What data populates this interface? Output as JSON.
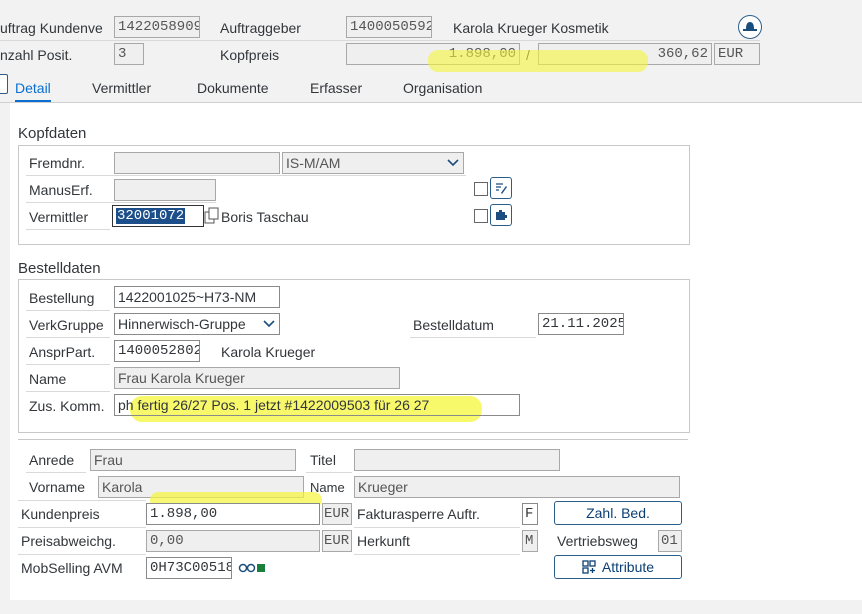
{
  "header": {
    "auftrag_label": "uftrag Kundenve",
    "auftrag_value": "1422058909",
    "auftraggeber_label": "Auftraggeber",
    "auftraggeber_value": "1400050592",
    "auftraggeber_name": "Karola Krueger Kosmetik",
    "anzahl_label": "nzahl Posit.",
    "anzahl_value": "3",
    "kopfpreis_label": "Kopfpreis",
    "kopfpreis_value": "1.898,00",
    "separator": "/",
    "kopfpreis_second": "360,62",
    "currency": "EUR"
  },
  "tabs": [
    "Detail",
    "Vermittler",
    "Dokumente",
    "Erfasser",
    "Organisation"
  ],
  "kopfdaten": {
    "title": "Kopfdaten",
    "fremdnr_label": "Fremdnr.",
    "fremdnr_value": "",
    "fremdnr_select": "IS-M/AM",
    "manuserf_label": "ManusErf.",
    "manuserf_value": "",
    "vermittler_label": "Vermittler",
    "vermittler_value": "32001072",
    "vermittler_name": "Boris Taschau"
  },
  "bestelldaten": {
    "title": "Bestelldaten",
    "bestellung_label": "Bestellung",
    "bestellung_value": "1422001025~H73-NM",
    "verkgruppe_label": "VerkGruppe",
    "verkgruppe_value": "Hinnerwisch-Gruppe",
    "bestelldatum_label": "Bestelldatum",
    "bestelldatum_value": "21.11.2025",
    "ansprpart_label": "AnsprPart.",
    "ansprpart_value": "1400052802",
    "ansprpart_name": "Karola Krueger",
    "name_label": "Name",
    "name_value": "Frau Karola Krueger",
    "zuskomm_label": "Zus. Komm.",
    "zuskomm_value": "ph fertig 26/27 Pos. 1 jetzt #1422009503 für 26 27"
  },
  "kunde": {
    "anrede_label": "Anrede",
    "anrede_value": "Frau",
    "titel_label": "Titel",
    "titel_value": "",
    "vorname_label": "Vorname",
    "vorname_value": "Karola",
    "name_label": "Name",
    "name_value": "Krueger",
    "kundenpreis_label": "Kundenpreis",
    "kundenpreis_value": "1.898,00",
    "kundenpreis_currency": "EUR",
    "fakturasperre_label": "Fakturasperre Auftr.",
    "fakturasperre_value": "F",
    "zahlbed_button": "Zahl. Bed.",
    "preisabw_label": "Preisabweichg.",
    "preisabw_value": "0,00",
    "preisabw_currency": "EUR",
    "herkunft_label": "Herkunft",
    "herkunft_value": "M",
    "vertriebsweg_label": "Vertriebsweg",
    "vertriebsweg_value": "01",
    "mobselling_label": "MobSelling AVM",
    "mobselling_value": "0H73C00518",
    "attribute_button": "Attribute"
  }
}
